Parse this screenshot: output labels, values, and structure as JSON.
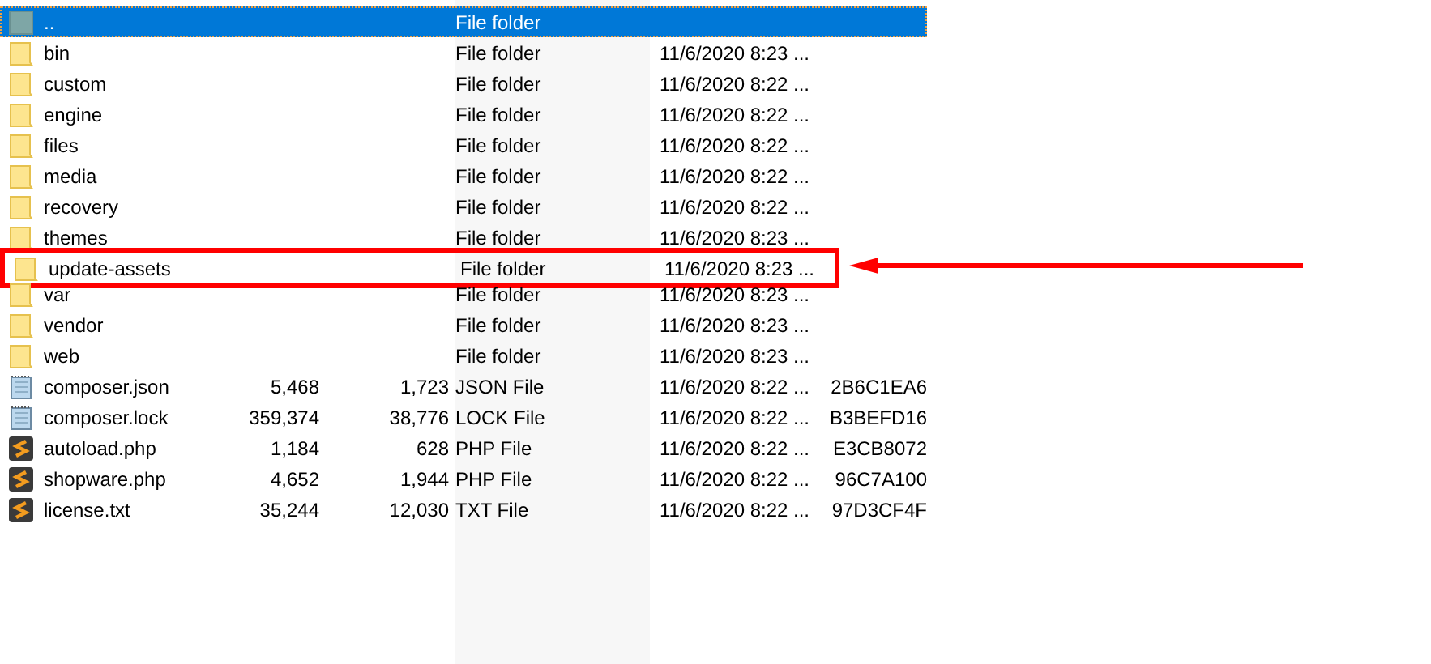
{
  "files": [
    {
      "kind": "parent",
      "name": "..",
      "type": "File folder",
      "selected": true,
      "highlighted": false
    },
    {
      "kind": "folder",
      "name": "bin",
      "type": "File folder",
      "modified": "11/6/2020 8:23 ...",
      "selected": false,
      "highlighted": false
    },
    {
      "kind": "folder",
      "name": "custom",
      "type": "File folder",
      "modified": "11/6/2020 8:22 ...",
      "selected": false,
      "highlighted": false
    },
    {
      "kind": "folder",
      "name": "engine",
      "type": "File folder",
      "modified": "11/6/2020 8:22 ...",
      "selected": false,
      "highlighted": false
    },
    {
      "kind": "folder",
      "name": "files",
      "type": "File folder",
      "modified": "11/6/2020 8:22 ...",
      "selected": false,
      "highlighted": false
    },
    {
      "kind": "folder",
      "name": "media",
      "type": "File folder",
      "modified": "11/6/2020 8:22 ...",
      "selected": false,
      "highlighted": false
    },
    {
      "kind": "folder",
      "name": "recovery",
      "type": "File folder",
      "modified": "11/6/2020 8:22 ...",
      "selected": false,
      "highlighted": false
    },
    {
      "kind": "folder",
      "name": "themes",
      "type": "File folder",
      "modified": "11/6/2020 8:23 ...",
      "selected": false,
      "highlighted": false
    },
    {
      "kind": "folder",
      "name": "update-assets",
      "type": "File folder",
      "modified": "11/6/2020 8:23 ...",
      "selected": false,
      "highlighted": true
    },
    {
      "kind": "folder",
      "name": "var",
      "type": "File folder",
      "modified": "11/6/2020 8:23 ...",
      "selected": false,
      "highlighted": false
    },
    {
      "kind": "folder",
      "name": "vendor",
      "type": "File folder",
      "modified": "11/6/2020 8:23 ...",
      "selected": false,
      "highlighted": false
    },
    {
      "kind": "folder",
      "name": "web",
      "type": "File folder",
      "modified": "11/6/2020 8:23 ...",
      "selected": false,
      "highlighted": false
    },
    {
      "kind": "text",
      "name": "composer.json",
      "size": "5,468",
      "packed": "1,723",
      "type": "JSON File",
      "modified": "11/6/2020 8:22 ...",
      "crc": "2B6C1EA6",
      "selected": false,
      "highlighted": false
    },
    {
      "kind": "text",
      "name": "composer.lock",
      "size": "359,374",
      "packed": "38,776",
      "type": "LOCK File",
      "modified": "11/6/2020 8:22 ...",
      "crc": "B3BEFD16",
      "selected": false,
      "highlighted": false
    },
    {
      "kind": "script",
      "name": "autoload.php",
      "size": "1,184",
      "packed": "628",
      "type": "PHP File",
      "modified": "11/6/2020 8:22 ...",
      "crc": "E3CB8072",
      "selected": false,
      "highlighted": false
    },
    {
      "kind": "script",
      "name": "shopware.php",
      "size": "4,652",
      "packed": "1,944",
      "type": "PHP File",
      "modified": "11/6/2020 8:22 ...",
      "crc": "96C7A100",
      "selected": false,
      "highlighted": false
    },
    {
      "kind": "script",
      "name": "license.txt",
      "size": "35,244",
      "packed": "12,030",
      "type": "TXT File",
      "modified": "11/6/2020 8:22 ...",
      "crc": "97D3CF4F",
      "selected": false,
      "highlighted": false
    }
  ]
}
